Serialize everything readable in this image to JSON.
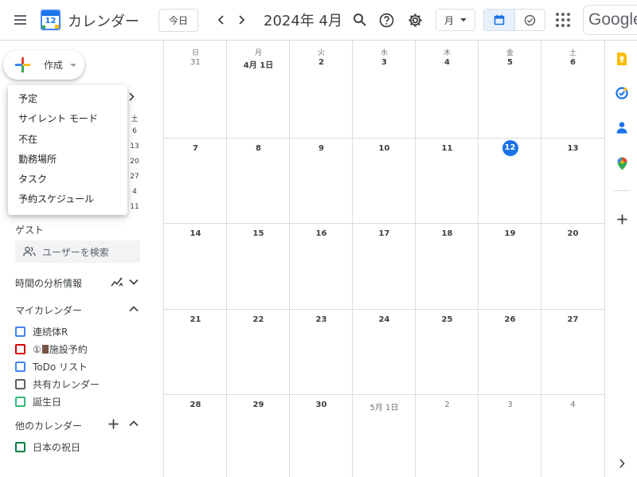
{
  "header": {
    "app_title": "カレンダー",
    "logo_day": "12",
    "today_label": "今日",
    "month_title": "2024年 4月",
    "view_label": "月",
    "google_label": "Google"
  },
  "create": {
    "label": "作成",
    "menu_items": [
      "予定",
      "サイレント モード",
      "不在",
      "勤務場所",
      "タスク",
      "予約スケジュール"
    ]
  },
  "mini_calendar": {
    "saturday_header": "土",
    "saturday_dates": [
      "6",
      "13",
      "20",
      "27",
      "4",
      "11"
    ]
  },
  "sidebar": {
    "guest_label": "ゲスト",
    "guest_search_placeholder": "ユーザーを検索",
    "analytics_label": "時間の分析情報",
    "my_calendars_label": "マイカレンダー",
    "my_calendars": [
      {
        "name": "連続体R",
        "color": "#4285f4"
      },
      {
        "name_prefix": "①",
        "name": "施設予約",
        "color": "#d50000"
      },
      {
        "name": "ToDo リスト",
        "color": "#4285f4"
      },
      {
        "name": "共有カレンダー",
        "color": "#616161"
      },
      {
        "name": "誕生日",
        "color": "#33b679"
      }
    ],
    "other_calendars_label": "他のカレンダー",
    "other_calendars": [
      {
        "name": "日本の祝日",
        "color": "#0b8043"
      }
    ]
  },
  "month": {
    "weekdays": [
      "日",
      "月",
      "火",
      "水",
      "木",
      "金",
      "土"
    ],
    "weeks": [
      [
        "31",
        "4月 1日",
        "2",
        "3",
        "4",
        "5",
        "6"
      ],
      [
        "7",
        "8",
        "9",
        "10",
        "11",
        "12",
        "13"
      ],
      [
        "14",
        "15",
        "16",
        "17",
        "18",
        "19",
        "20"
      ],
      [
        "21",
        "22",
        "23",
        "24",
        "25",
        "26",
        "27"
      ],
      [
        "28",
        "29",
        "30",
        "5月 1日",
        "2",
        "3",
        "4"
      ]
    ],
    "today": "12",
    "accent_color": "#1a73e8"
  },
  "right_panel": {
    "icons": [
      "keep-icon",
      "tasks-icon",
      "contacts-icon",
      "maps-icon",
      "add-icon",
      "chevron-right-icon"
    ]
  }
}
